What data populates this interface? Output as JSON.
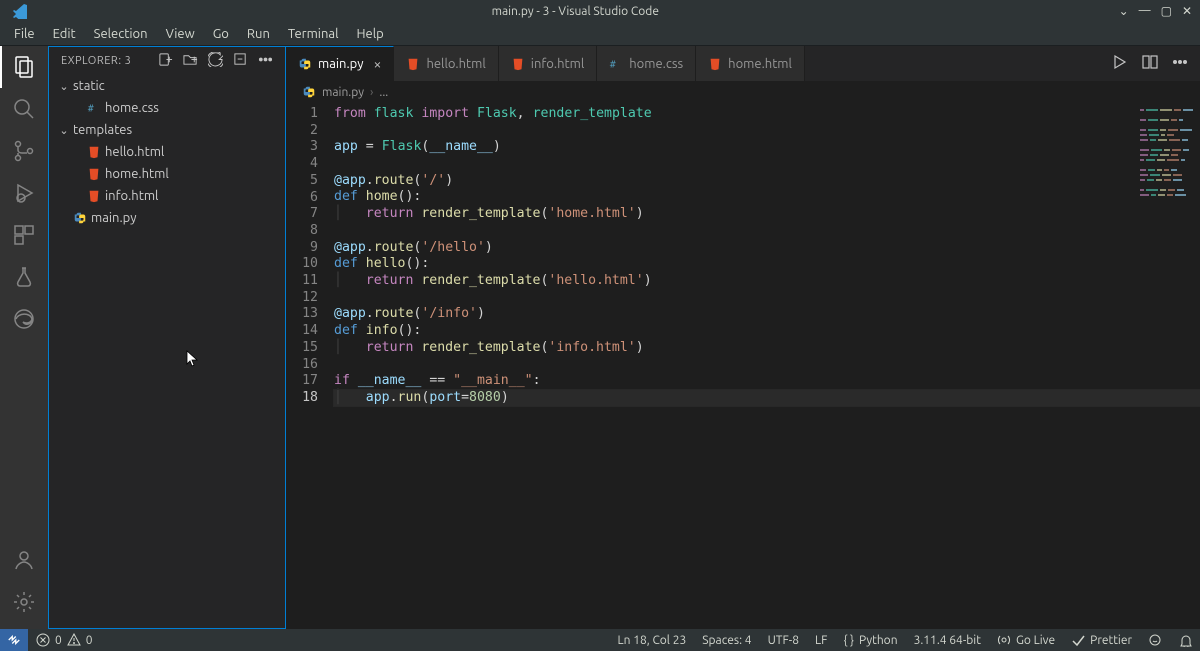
{
  "window": {
    "title": "main.py - 3 - Visual Studio Code"
  },
  "menu": {
    "items": [
      "File",
      "Edit",
      "Selection",
      "View",
      "Go",
      "Run",
      "Terminal",
      "Help"
    ]
  },
  "activity": {
    "explorer": "Explorer",
    "search": "Search",
    "scm": "Source Control",
    "run": "Run and Debug",
    "extensions": "Extensions",
    "testing": "Testing",
    "edge": "Edge Tools",
    "accounts": "Accounts",
    "settings": "Manage"
  },
  "sidebar": {
    "title": "EXPLORER: 3",
    "actions": {
      "newfile": "New File",
      "newfolder": "New Folder",
      "refresh": "Refresh",
      "collapse": "Collapse",
      "more": "More Actions"
    },
    "tree": {
      "static": {
        "label": "static",
        "children": {
          "homecss": "home.css"
        }
      },
      "templates": {
        "label": "templates",
        "children": {
          "hello": "hello.html",
          "home": "home.html",
          "info": "info.html"
        }
      },
      "mainpy": "main.py"
    }
  },
  "tabs": {
    "main": {
      "label": "main.py",
      "icon": "python"
    },
    "hello": {
      "label": "hello.html",
      "icon": "html"
    },
    "info": {
      "label": "info.html",
      "icon": "html"
    },
    "css": {
      "label": "home.css",
      "icon": "css"
    },
    "home": {
      "label": "home.html",
      "icon": "html"
    }
  },
  "breadcrumb": {
    "file": "main.py",
    "rest": "..."
  },
  "status": {
    "errors": "0",
    "warnings": "0",
    "cursor": "Ln 18, Col 23",
    "spaces": "Spaces: 4",
    "encoding": "UTF-8",
    "eol": "LF",
    "lang": "Python",
    "ver": "3.11.4 64-bit",
    "golive": "Go Live",
    "prettier": "Prettier"
  },
  "code": {
    "lines": [
      {
        "n": 1,
        "t": [
          [
            "kw",
            "from"
          ],
          [
            "plain",
            " "
          ],
          [
            "mod",
            "flask"
          ],
          [
            "plain",
            " "
          ],
          [
            "kw",
            "import"
          ],
          [
            "plain",
            " "
          ],
          [
            "mod",
            "Flask"
          ],
          [
            "punc",
            ", "
          ],
          [
            "mod",
            "render_template"
          ]
        ]
      },
      {
        "n": 2,
        "t": []
      },
      {
        "n": 3,
        "t": [
          [
            "var",
            "app"
          ],
          [
            "plain",
            " "
          ],
          [
            "op",
            "="
          ],
          [
            "plain",
            " "
          ],
          [
            "mod",
            "Flask"
          ],
          [
            "punc",
            "("
          ],
          [
            "var",
            "__name__"
          ],
          [
            "punc",
            ")"
          ]
        ]
      },
      {
        "n": 4,
        "t": []
      },
      {
        "n": 5,
        "t": [
          [
            "at",
            "@app"
          ],
          [
            "punc",
            "."
          ],
          [
            "deco",
            "route"
          ],
          [
            "punc",
            "("
          ],
          [
            "str",
            "'/'"
          ],
          [
            "punc",
            ")"
          ]
        ]
      },
      {
        "n": 6,
        "t": [
          [
            "def",
            "def"
          ],
          [
            "plain",
            " "
          ],
          [
            "fn",
            "home"
          ],
          [
            "punc",
            "():"
          ]
        ]
      },
      {
        "n": 7,
        "t": [
          [
            "indent",
            "    "
          ],
          [
            "kw",
            "return"
          ],
          [
            "plain",
            " "
          ],
          [
            "fn",
            "render_template"
          ],
          [
            "punc",
            "("
          ],
          [
            "str",
            "'home.html'"
          ],
          [
            "punc",
            ")"
          ]
        ]
      },
      {
        "n": 8,
        "t": []
      },
      {
        "n": 9,
        "t": [
          [
            "at",
            "@app"
          ],
          [
            "punc",
            "."
          ],
          [
            "deco",
            "route"
          ],
          [
            "punc",
            "("
          ],
          [
            "str",
            "'/hello'"
          ],
          [
            "punc",
            ")"
          ]
        ]
      },
      {
        "n": 10,
        "t": [
          [
            "def",
            "def"
          ],
          [
            "plain",
            " "
          ],
          [
            "fn",
            "hello"
          ],
          [
            "punc",
            "():"
          ]
        ]
      },
      {
        "n": 11,
        "t": [
          [
            "indent",
            "    "
          ],
          [
            "kw",
            "return"
          ],
          [
            "plain",
            " "
          ],
          [
            "fn",
            "render_template"
          ],
          [
            "punc",
            "("
          ],
          [
            "str",
            "'hello.html'"
          ],
          [
            "punc",
            ")"
          ]
        ]
      },
      {
        "n": 12,
        "t": []
      },
      {
        "n": 13,
        "t": [
          [
            "at",
            "@app"
          ],
          [
            "punc",
            "."
          ],
          [
            "deco",
            "route"
          ],
          [
            "punc",
            "("
          ],
          [
            "str",
            "'/info'"
          ],
          [
            "punc",
            ")"
          ]
        ]
      },
      {
        "n": 14,
        "t": [
          [
            "def",
            "def"
          ],
          [
            "plain",
            " "
          ],
          [
            "fn",
            "info"
          ],
          [
            "punc",
            "():"
          ]
        ]
      },
      {
        "n": 15,
        "t": [
          [
            "indent",
            "    "
          ],
          [
            "kw",
            "return"
          ],
          [
            "plain",
            " "
          ],
          [
            "fn",
            "render_template"
          ],
          [
            "punc",
            "("
          ],
          [
            "str",
            "'info.html'"
          ],
          [
            "punc",
            ")"
          ]
        ]
      },
      {
        "n": 16,
        "t": []
      },
      {
        "n": 17,
        "t": [
          [
            "kw",
            "if"
          ],
          [
            "plain",
            " "
          ],
          [
            "var",
            "__name__"
          ],
          [
            "plain",
            " "
          ],
          [
            "op",
            "=="
          ],
          [
            "plain",
            " "
          ],
          [
            "str",
            "\"__main__\""
          ],
          [
            "punc",
            ":"
          ]
        ]
      },
      {
        "n": 18,
        "cur": true,
        "t": [
          [
            "indent",
            "    "
          ],
          [
            "var",
            "app"
          ],
          [
            "punc",
            "."
          ],
          [
            "fn",
            "run"
          ],
          [
            "punc",
            "("
          ],
          [
            "var",
            "port"
          ],
          [
            "op",
            "="
          ],
          [
            "num",
            "8080"
          ],
          [
            "punc",
            ")"
          ]
        ]
      }
    ]
  }
}
